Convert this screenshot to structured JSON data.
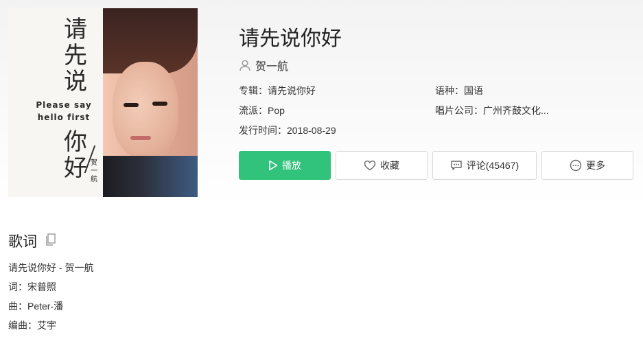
{
  "cover": {
    "title_top": "请先说",
    "title_bottom": "你好",
    "english_line1": "Please say",
    "english_line2": "hello first",
    "artist_small": "贺一航"
  },
  "song": {
    "title": "请先说你好",
    "artist": "贺一航",
    "album_label": "专辑：",
    "album_value": "请先说你好",
    "genre_label": "流派：",
    "genre_value": "Pop",
    "date_label": "发行时间：",
    "date_value": "2018-08-29",
    "language_label": "语种：",
    "language_value": "国语",
    "company_label": "唱片公司：",
    "company_value": "广州齐鼓文化..."
  },
  "actions": {
    "play": "播放",
    "favorite": "收藏",
    "comment": "评论(45467)",
    "more": "更多"
  },
  "lyrics": {
    "heading": "歌词",
    "lines": [
      "请先说你好 - 贺一航",
      "词：宋普照",
      "曲：Peter-潘",
      "编曲：艾宇"
    ]
  },
  "colors": {
    "accent": "#31c27c",
    "border": "#d9d9d9",
    "text": "#333333"
  },
  "icons": {
    "artist": "person-icon",
    "play": "play-icon",
    "favorite": "heart-icon",
    "comment": "comment-icon",
    "more": "more-icon",
    "copy": "copy-icon"
  }
}
